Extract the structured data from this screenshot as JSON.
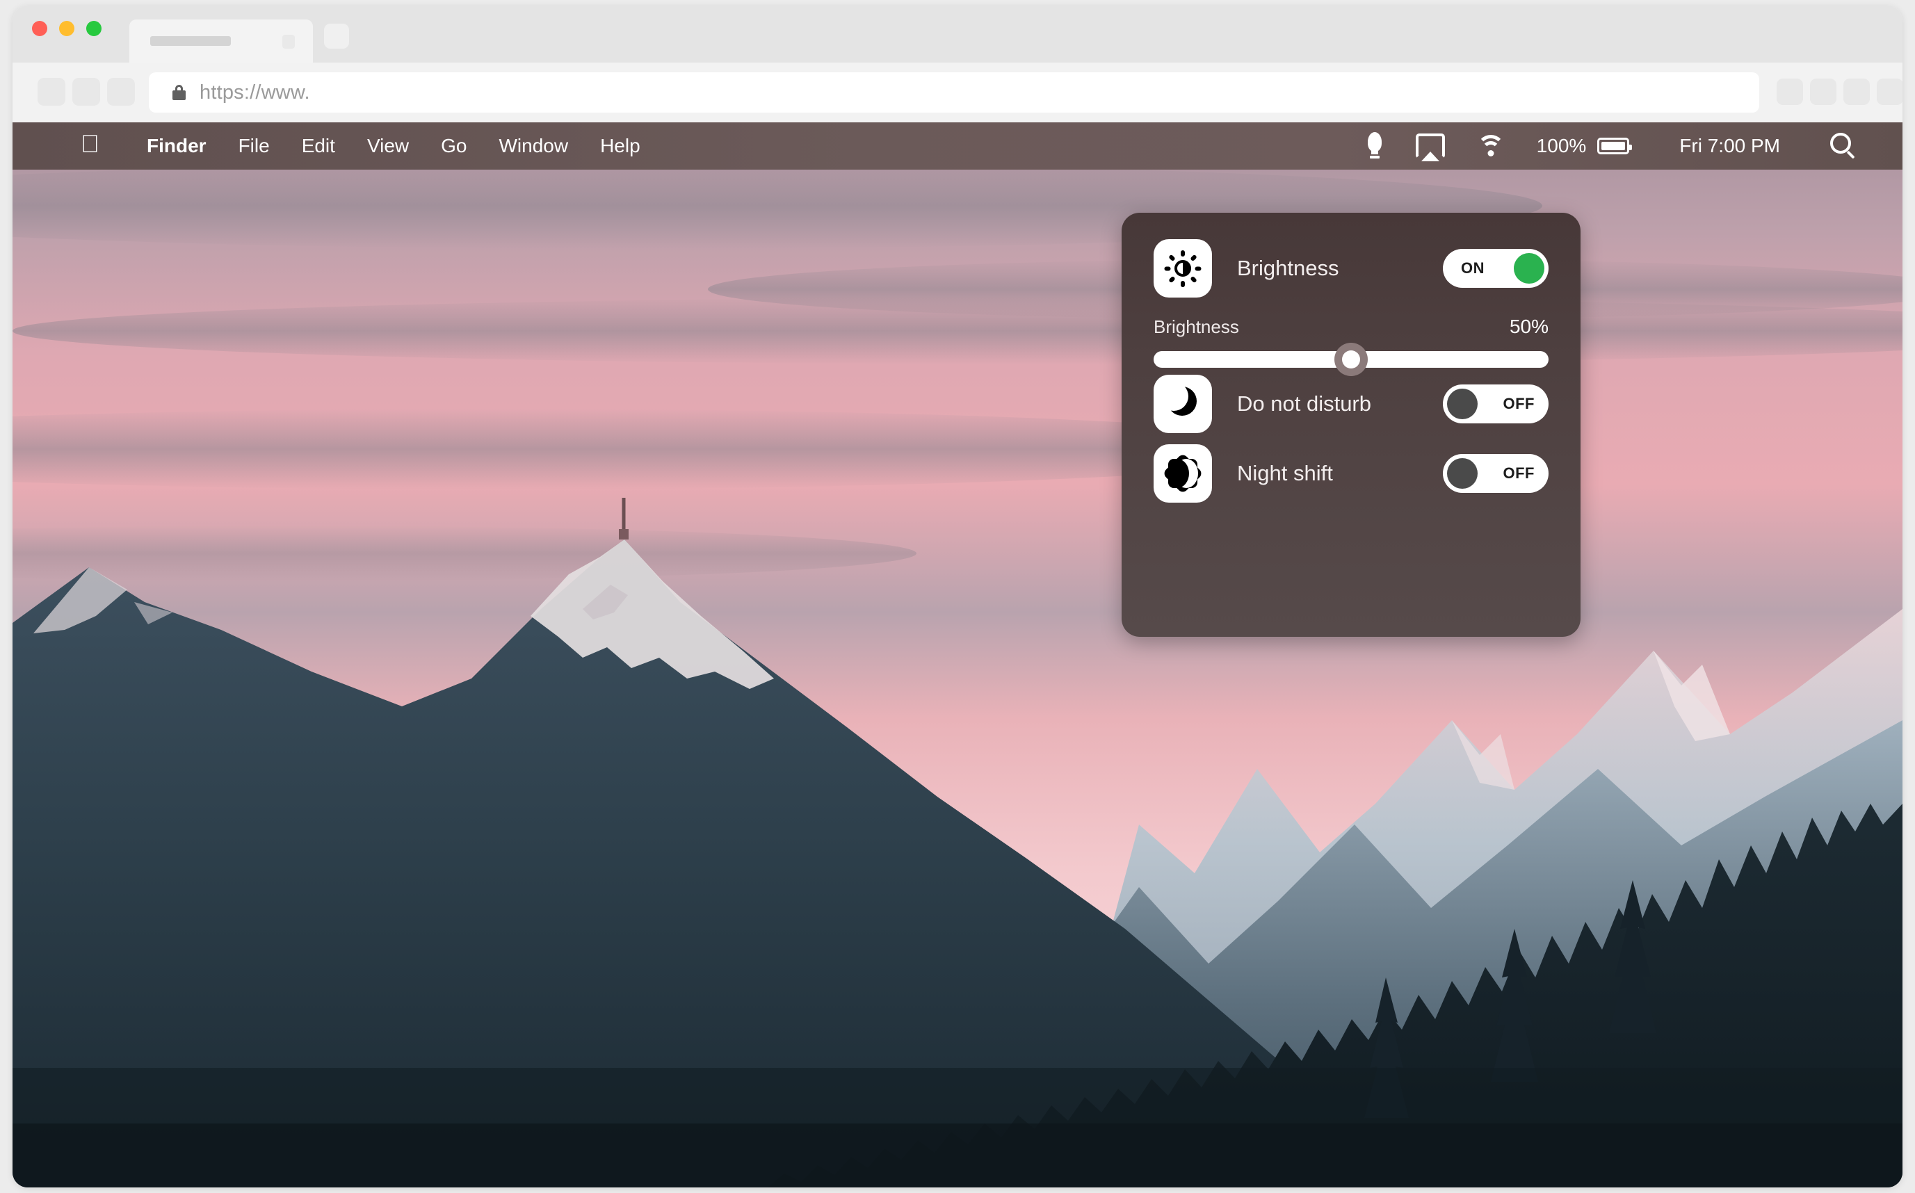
{
  "browser": {
    "traffic_lights": [
      {
        "name": "close",
        "color": "#ff5f56"
      },
      {
        "name": "minimize",
        "color": "#ffbd2e"
      },
      {
        "name": "zoom",
        "color": "#27c93f"
      }
    ],
    "tab": {
      "title": "",
      "close_label": ""
    },
    "new_tab_label": "+",
    "url_value": "https://www.",
    "url_placeholder": "https://www.",
    "lock_icon": "lock-icon",
    "nav_buttons": [
      "back-button",
      "forward-button",
      "reload-button"
    ],
    "right_buttons": [
      "extension-button-1",
      "extension-button-2",
      "extension-button-3",
      "menu-button"
    ]
  },
  "menubar": {
    "apple_logo": "",
    "items": [
      {
        "label": "Finder",
        "bold": true
      },
      {
        "label": "File",
        "bold": false
      },
      {
        "label": "Edit",
        "bold": false
      },
      {
        "label": "View",
        "bold": false
      },
      {
        "label": "Go",
        "bold": false
      },
      {
        "label": "Window",
        "bold": false
      },
      {
        "label": "Help",
        "bold": false
      }
    ],
    "status": {
      "bulb_icon": "lightbulb-icon",
      "airplay_icon": "airplay-icon",
      "wifi_icon": "wifi-icon",
      "battery_percent": "100%",
      "battery_icon": "battery-icon",
      "clock": "Fri 7:00 PM",
      "search_icon": "search-icon"
    },
    "background_color": "#6b5a59",
    "text_color": "#ffffff"
  },
  "control_panel": {
    "background_color": "#4e4040",
    "accent_on_color": "#2ab24f",
    "knob_off_color": "#4a4a4a",
    "rows": [
      {
        "id": "brightness",
        "icon": "brightness-icon",
        "label": "Brightness",
        "toggle_state": "ON",
        "toggle_on": true
      },
      {
        "id": "do-not-disturb",
        "icon": "moon-icon",
        "label": "Do not disturb",
        "toggle_state": "OFF",
        "toggle_on": false
      },
      {
        "id": "night-shift",
        "icon": "night-shift-icon",
        "label": "Night shift",
        "toggle_state": "OFF",
        "toggle_on": false
      }
    ],
    "slider": {
      "label": "Brightness",
      "value_text": "50%",
      "value": 50,
      "min": 0,
      "max": 100
    }
  },
  "wallpaper": {
    "description": "mountain-sunset-wallpaper",
    "sky_top_color": "#b9a0ab",
    "sky_mid_color": "#e7a8b0",
    "sky_low_color": "#f4d4d7",
    "mountain_color": "#2c3c46",
    "forest_color": "#16222a"
  }
}
